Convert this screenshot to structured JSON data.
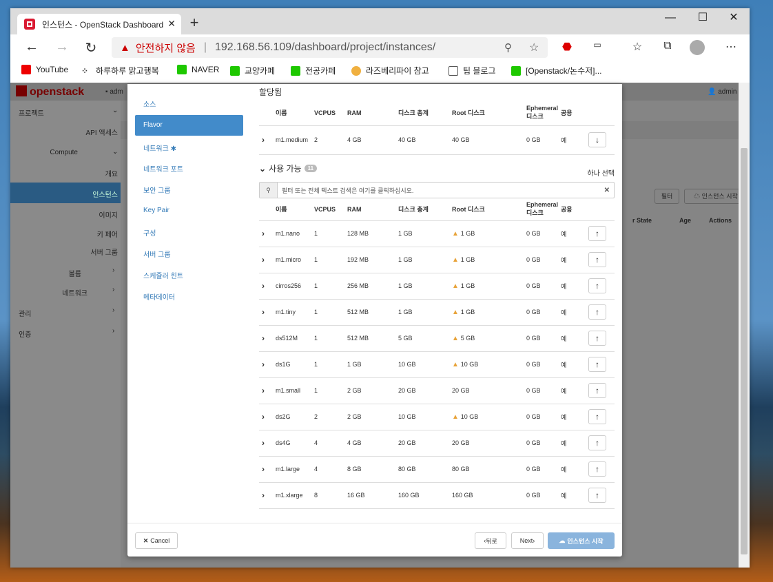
{
  "browser": {
    "tab_title": "인스턴스 - OpenStack Dashboard",
    "security_warning": "안전하지 않음",
    "url": "192.168.56.109/dashboard/project/instances/",
    "bookmarks": [
      "YouTube",
      "하루하루 맑고행복",
      "NAVER",
      "교양카페",
      "전공카페",
      "라즈베리파이 참고",
      "팁 블로그",
      "[Openstack/논수저]..."
    ]
  },
  "openstack": {
    "logo": "openstack",
    "user": "admin",
    "sidebar": [
      "프로젝트",
      "API 액세스",
      "Compute",
      "개요",
      "인스턴스",
      "이미지",
      "키 페어",
      "서버 그룹",
      "볼륨",
      "네트워크",
      "관리",
      "인증"
    ],
    "bg_buttons": [
      "필터",
      "인스턴스 시작"
    ],
    "bg_headers": [
      "r State",
      "Age",
      "Actions"
    ]
  },
  "wizard": {
    "nav": [
      "소스",
      "Flavor",
      "네트워크 ✱",
      "네트워크 포트",
      "보안 그룹",
      "Key Pair",
      "구성",
      "서버 그룹",
      "스케쥴러 힌트",
      "메타데이터"
    ],
    "allocated_title": "할당됨",
    "columns": [
      "이름",
      "VCPUS",
      "RAM",
      "디스크 총계",
      "Root 디스크",
      "Ephemeral 디스크",
      "공용"
    ],
    "allocated": [
      {
        "name": "m1.medium",
        "vcpus": "2",
        "ram": "4 GB",
        "disk": "40 GB",
        "root": "40 GB",
        "eph": "0 GB",
        "public": "예",
        "warn": false
      }
    ],
    "available_title": "사용 가능",
    "available_count": "11",
    "select_one": "하나 선택",
    "filter_placeholder": "필터 또는 전체 텍스트 검색은 여기를 클릭하십시오.",
    "available": [
      {
        "name": "m1.nano",
        "vcpus": "1",
        "ram": "128 MB",
        "disk": "1 GB",
        "root": "1 GB",
        "eph": "0 GB",
        "public": "예",
        "warn": true
      },
      {
        "name": "m1.micro",
        "vcpus": "1",
        "ram": "192 MB",
        "disk": "1 GB",
        "root": "1 GB",
        "eph": "0 GB",
        "public": "예",
        "warn": true
      },
      {
        "name": "cirros256",
        "vcpus": "1",
        "ram": "256 MB",
        "disk": "1 GB",
        "root": "1 GB",
        "eph": "0 GB",
        "public": "예",
        "warn": true
      },
      {
        "name": "m1.tiny",
        "vcpus": "1",
        "ram": "512 MB",
        "disk": "1 GB",
        "root": "1 GB",
        "eph": "0 GB",
        "public": "예",
        "warn": true
      },
      {
        "name": "ds512M",
        "vcpus": "1",
        "ram": "512 MB",
        "disk": "5 GB",
        "root": "5 GB",
        "eph": "0 GB",
        "public": "예",
        "warn": true
      },
      {
        "name": "ds1G",
        "vcpus": "1",
        "ram": "1 GB",
        "disk": "10 GB",
        "root": "10 GB",
        "eph": "0 GB",
        "public": "예",
        "warn": true
      },
      {
        "name": "m1.small",
        "vcpus": "1",
        "ram": "2 GB",
        "disk": "20 GB",
        "root": "20 GB",
        "eph": "0 GB",
        "public": "예",
        "warn": false
      },
      {
        "name": "ds2G",
        "vcpus": "2",
        "ram": "2 GB",
        "disk": "10 GB",
        "root": "10 GB",
        "eph": "0 GB",
        "public": "예",
        "warn": true
      },
      {
        "name": "ds4G",
        "vcpus": "4",
        "ram": "4 GB",
        "disk": "20 GB",
        "root": "20 GB",
        "eph": "0 GB",
        "public": "예",
        "warn": false
      },
      {
        "name": "m1.large",
        "vcpus": "4",
        "ram": "8 GB",
        "disk": "80 GB",
        "root": "80 GB",
        "eph": "0 GB",
        "public": "예",
        "warn": false
      },
      {
        "name": "m1.xlarge",
        "vcpus": "8",
        "ram": "16 GB",
        "disk": "160 GB",
        "root": "160 GB",
        "eph": "0 GB",
        "public": "예",
        "warn": false
      }
    ],
    "footer": {
      "cancel": "Cancel",
      "back": "뒤로",
      "next": "Next",
      "launch": "인스턴스 시작"
    }
  }
}
